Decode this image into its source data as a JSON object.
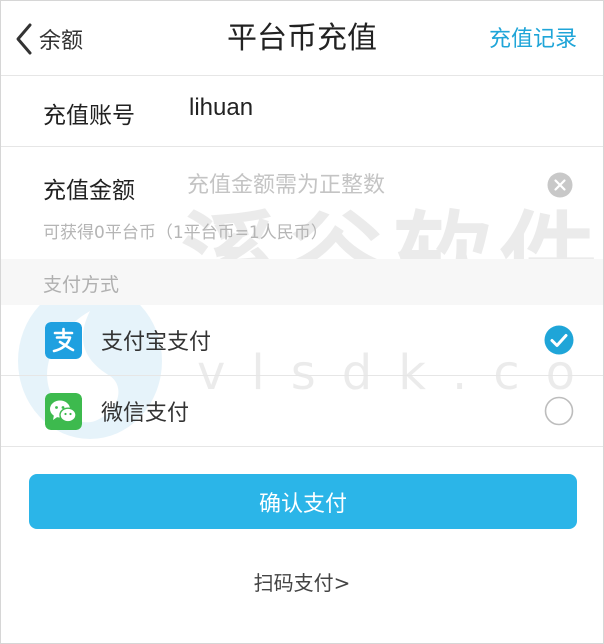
{
  "header": {
    "back_label": "余额",
    "title": "平台币充值",
    "records_link": "充值记录"
  },
  "account": {
    "label": "充值账号",
    "value": "lihuan"
  },
  "amount": {
    "label": "充值金额",
    "value": "",
    "placeholder": "充值金额需为正整数",
    "hint": "可获得0平台币（1平台币=1人民币）"
  },
  "payment": {
    "section_title": "支付方式",
    "methods": [
      {
        "label": "支付宝支付",
        "icon": "alipay-icon",
        "color": "#1fa0e0",
        "selected": true
      },
      {
        "label": "微信支付",
        "icon": "wechat-icon",
        "color": "#3dba4e",
        "selected": false
      }
    ]
  },
  "actions": {
    "confirm_label": "确认支付",
    "scan_label": "扫码支付>"
  },
  "watermark": {
    "text": "溪谷软件",
    "sub": "vlsdk.com"
  },
  "colors": {
    "accent": "#1fa5d8",
    "button": "#2bb5e8"
  }
}
